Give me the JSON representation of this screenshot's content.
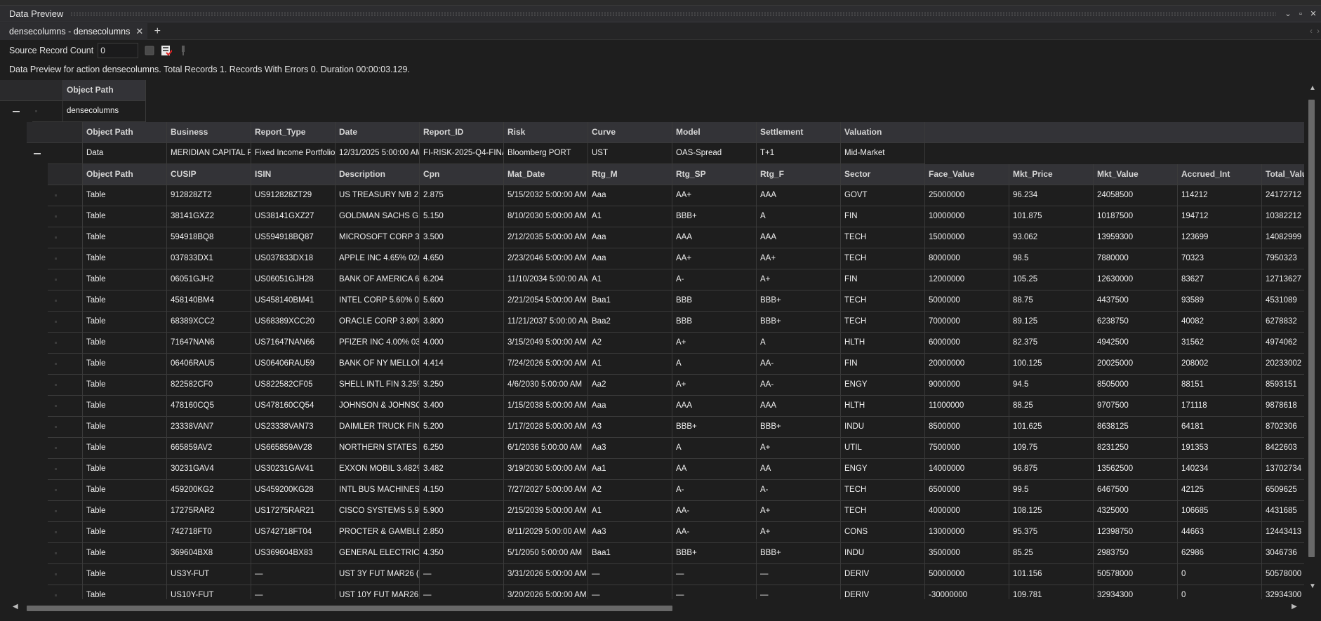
{
  "window": {
    "title": "Data Preview"
  },
  "tab": {
    "label": "densecolumns - densecolumns"
  },
  "toolbar": {
    "source_label": "Source Record Count",
    "source_value": "0"
  },
  "status_text": "Data Preview for action densecolumns. Total Records 1. Records With Errors 0. Duration 00:00:03.129.",
  "level1": {
    "header": "Object Path",
    "value": "densecolumns"
  },
  "level2": {
    "headers": [
      "Object Path",
      "Business",
      "Report_Type",
      "Date",
      "Report_ID",
      "Risk",
      "Curve",
      "Model",
      "Settlement",
      "Valuation"
    ],
    "row": [
      "Data",
      "MERIDIAN CAPITAL PA",
      "Fixed Income Portfolio",
      "12/31/2025 5:00:00 AM",
      "FI-RISK-2025-Q4-FINA",
      "Bloomberg PORT",
      "UST",
      "OAS-Spread",
      "T+1",
      "Mid-Market"
    ]
  },
  "level3": {
    "headers": [
      "Object Path",
      "CUSIP",
      "ISIN",
      "Description",
      "Cpn",
      "Mat_Date",
      "Rtg_M",
      "Rtg_SP",
      "Rtg_F",
      "Sector",
      "Face_Value",
      "Mkt_Price",
      "Mkt_Value",
      "Accrued_Int",
      "Total_Valu"
    ],
    "rows": [
      [
        "Table",
        "912828ZT2",
        "US912828ZT29",
        "US TREASURY N/B 2.87",
        "2.875",
        "5/15/2032 5:00:00 AM",
        "Aaa",
        "AA+",
        "AAA",
        "GOVT",
        "25000000",
        "96.234",
        "24058500",
        "114212",
        "24172712"
      ],
      [
        "Table",
        "38141GXZ2",
        "US38141GXZ27",
        "GOLDMAN SACHS GRI",
        "5.150",
        "8/10/2030 5:00:00 AM",
        "A1",
        "BBB+",
        "A",
        "FIN",
        "10000000",
        "101.875",
        "10187500",
        "194712",
        "10382212"
      ],
      [
        "Table",
        "594918BQ8",
        "US594918BQ87",
        "MICROSOFT CORP 3.5(",
        "3.500",
        "2/12/2035 5:00:00 AM",
        "Aaa",
        "AAA",
        "AAA",
        "TECH",
        "15000000",
        "93.062",
        "13959300",
        "123699",
        "14082999"
      ],
      [
        "Table",
        "037833DX1",
        "US037833DX18",
        "APPLE INC 4.65% 02/4(",
        "4.650",
        "2/23/2046 5:00:00 AM",
        "Aaa",
        "AA+",
        "AA+",
        "TECH",
        "8000000",
        "98.5",
        "7880000",
        "70323",
        "7950323"
      ],
      [
        "Table",
        "06051GJH2",
        "US06051GJH28",
        "BANK OF AMERICA 6.2",
        "6.204",
        "11/10/2034 5:00:00 AM",
        "A1",
        "A-",
        "A+",
        "FIN",
        "12000000",
        "105.25",
        "12630000",
        "83627",
        "12713627"
      ],
      [
        "Table",
        "458140BM4",
        "US458140BM41",
        "INTEL CORP 5.60% 02/",
        "5.600",
        "2/21/2054 5:00:00 AM",
        "Baa1",
        "BBB",
        "BBB+",
        "TECH",
        "5000000",
        "88.75",
        "4437500",
        "93589",
        "4531089"
      ],
      [
        "Table",
        "68389XCC2",
        "US68389XCC20",
        "ORACLE CORP 3.80% 1",
        "3.800",
        "11/21/2037 5:00:00 AM",
        "Baa2",
        "BBB",
        "BBB+",
        "TECH",
        "7000000",
        "89.125",
        "6238750",
        "40082",
        "6278832"
      ],
      [
        "Table",
        "71647NAN6",
        "US71647NAN66",
        "PFIZER INC 4.00% 03/4",
        "4.000",
        "3/15/2049 5:00:00 AM",
        "A2",
        "A+",
        "A",
        "HLTH",
        "6000000",
        "82.375",
        "4942500",
        "31562",
        "4974062"
      ],
      [
        "Table",
        "06406RAU5",
        "US06406RAU59",
        "BANK OF NY MELLON",
        "4.414",
        "7/24/2026 5:00:00 AM",
        "A1",
        "A",
        "AA-",
        "FIN",
        "20000000",
        "100.125",
        "20025000",
        "208002",
        "20233002"
      ],
      [
        "Table",
        "822582CF0",
        "US822582CF05",
        "SHELL INTL FIN 3.25%",
        "3.250",
        "4/6/2030 5:00:00 AM",
        "Aa2",
        "A+",
        "AA-",
        "ENGY",
        "9000000",
        "94.5",
        "8505000",
        "88151",
        "8593151"
      ],
      [
        "Table",
        "478160CQ5",
        "US478160CQ54",
        "JOHNSON & JOHNSOI",
        "3.400",
        "1/15/2038 5:00:00 AM",
        "Aaa",
        "AAA",
        "AAA",
        "HLTH",
        "11000000",
        "88.25",
        "9707500",
        "171118",
        "9878618"
      ],
      [
        "Table",
        "23338VAN7",
        "US23338VAN73",
        "DAIMLER TRUCK FIN 5",
        "5.200",
        "1/17/2028 5:00:00 AM",
        "A3",
        "BBB+",
        "BBB+",
        "INDU",
        "8500000",
        "101.625",
        "8638125",
        "64181",
        "8702306"
      ],
      [
        "Table",
        "665859AV2",
        "US665859AV28",
        "NORTHERN STATES PW",
        "6.250",
        "6/1/2036 5:00:00 AM",
        "Aa3",
        "A",
        "A+",
        "UTIL",
        "7500000",
        "109.75",
        "8231250",
        "191353",
        "8422603"
      ],
      [
        "Table",
        "30231GAV4",
        "US30231GAV41",
        "EXXON MOBIL 3.482%",
        "3.482",
        "3/19/2030 5:00:00 AM",
        "Aa1",
        "AA",
        "AA",
        "ENGY",
        "14000000",
        "96.875",
        "13562500",
        "140234",
        "13702734"
      ],
      [
        "Table",
        "459200KG2",
        "US459200KG28",
        "INTL BUS MACHINES 4",
        "4.150",
        "7/27/2027 5:00:00 AM",
        "A2",
        "A-",
        "A-",
        "TECH",
        "6500000",
        "99.5",
        "6467500",
        "42125",
        "6509625"
      ],
      [
        "Table",
        "17275RAR2",
        "US17275RAR21",
        "CISCO SYSTEMS 5.90%",
        "5.900",
        "2/15/2039 5:00:00 AM",
        "A1",
        "AA-",
        "A+",
        "TECH",
        "4000000",
        "108.125",
        "4325000",
        "106685",
        "4431685"
      ],
      [
        "Table",
        "742718FT0",
        "US742718FT04",
        "PROCTER & GAMBLE 2",
        "2.850",
        "8/11/2029 5:00:00 AM",
        "Aa3",
        "AA-",
        "A+",
        "CONS",
        "13000000",
        "95.375",
        "12398750",
        "44663",
        "12443413"
      ],
      [
        "Table",
        "369604BX8",
        "US369604BX83",
        "GENERAL ELECTRIC 4.3",
        "4.350",
        "5/1/2050 5:00:00 AM",
        "Baa1",
        "BBB+",
        "BBB+",
        "INDU",
        "3500000",
        "85.25",
        "2983750",
        "62986",
        "3046736"
      ],
      [
        "Table",
        "US3Y-FUT",
        "—",
        "UST 3Y FUT MAR26 (TU",
        "—",
        "3/31/2026 5:00:00 AM",
        "—",
        "—",
        "—",
        "DERIV",
        "50000000",
        "101.156",
        "50578000",
        "0",
        "50578000"
      ],
      [
        "Table",
        "US10Y-FUT",
        "—",
        "UST 10Y FUT MAR26 (T",
        "—",
        "3/20/2026 5:00:00 AM",
        "—",
        "—",
        "—",
        "DERIV",
        "-30000000",
        "109.781",
        "32934300",
        "0",
        "32934300"
      ]
    ]
  }
}
